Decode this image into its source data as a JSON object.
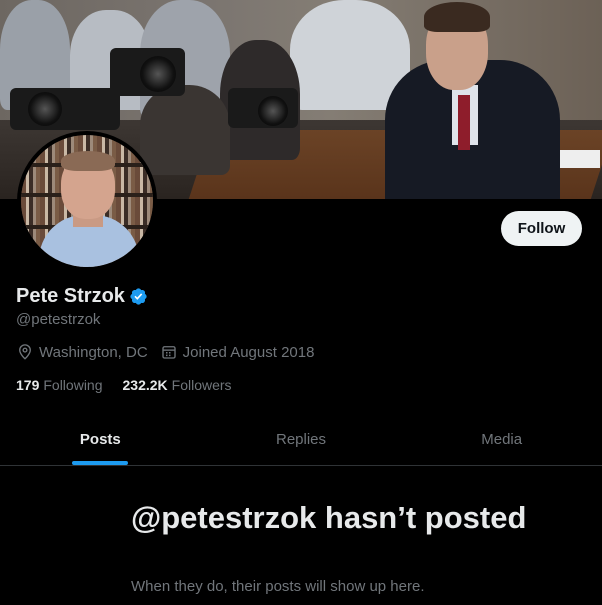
{
  "profile": {
    "name": "Pete Strzok",
    "handle": "@petestrzok",
    "location": "Washington, DC",
    "joined": "Joined August 2018",
    "verified": true,
    "badge_color": "#1d9bf0"
  },
  "actions": {
    "follow_label": "Follow"
  },
  "stats": {
    "following_count": "179",
    "following_label": "Following",
    "followers_count": "232.2K",
    "followers_label": "Followers"
  },
  "tabs": [
    {
      "label": "Posts",
      "active": true
    },
    {
      "label": "Replies",
      "active": false
    },
    {
      "label": "Media",
      "active": false
    }
  ],
  "empty_state": {
    "title": "@petestrzok hasn’t posted",
    "subtitle": "When they do, their posts will show up here."
  },
  "icons": {
    "location": "location-pin-icon",
    "calendar": "calendar-icon",
    "verified": "verified-badge-icon"
  },
  "colors": {
    "background": "#000000",
    "accent": "#1d9bf0",
    "secondary_text": "#71767b"
  }
}
